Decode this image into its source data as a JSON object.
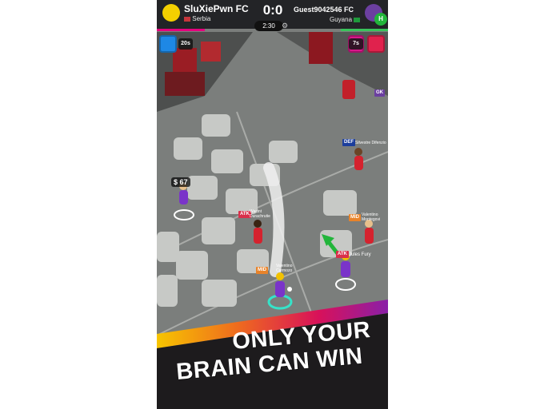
{
  "home": {
    "club": "SluXiePwn FC",
    "country": "Serbia",
    "colors": {
      "crest": "#f4d000",
      "bar": "#e6007e"
    }
  },
  "away": {
    "club": "Guest9042546 FC",
    "country": "Guyana",
    "colors": {
      "crest": "#6b3fa0",
      "bar": "#39c35b"
    }
  },
  "match": {
    "score": "0:0",
    "clock": "2:30"
  },
  "cards": {
    "home_timer": "20s",
    "away_timer": "7s"
  },
  "markers": {
    "gk": "GK",
    "money_value": "67",
    "money_symbol": "$"
  },
  "players": [
    {
      "role": "DEF",
      "name": "Silvestre Difenzio",
      "team": "away"
    },
    {
      "role": "ATK",
      "name": "Wacint Durachrutie",
      "team": "home"
    },
    {
      "role": "MID",
      "name": "Valentino Montegovi",
      "team": "away"
    },
    {
      "role": "ATK",
      "name": "Jules Fury",
      "team": "home"
    },
    {
      "role": "MID",
      "name": "Valentino Carmozo",
      "team": "home"
    }
  ],
  "slogan": {
    "line1": "ONLY YOUR",
    "line2": "BRAIN CAN WIN"
  },
  "colors": {
    "court": "#7b7e7c",
    "tile": "#c7c9c6",
    "banner_dark": "#1d1b1d",
    "accent_red": "#d9304b",
    "tag_red": "#d9304b",
    "tag_blue": "#1c3e9c",
    "tag_orange": "#e8832a"
  }
}
